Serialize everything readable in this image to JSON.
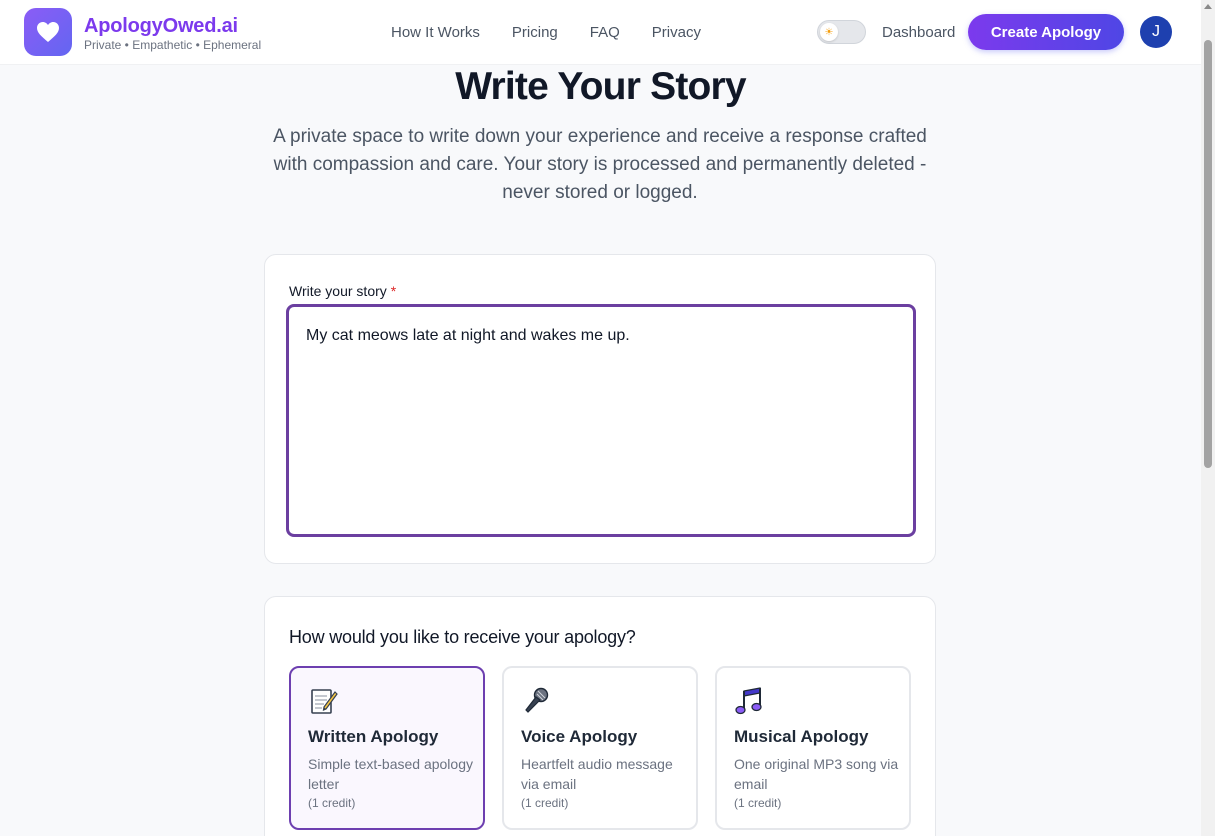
{
  "brand": {
    "name": "ApologyOwed.ai",
    "tagline": "Private • Empathetic • Ephemeral"
  },
  "nav": {
    "items": [
      {
        "label": "How It Works"
      },
      {
        "label": "Pricing"
      },
      {
        "label": "FAQ"
      },
      {
        "label": "Privacy"
      }
    ],
    "dashboard_label": "Dashboard",
    "create_label": "Create Apology",
    "avatar_initial": "J",
    "theme_toggle_icon": "sun-icon"
  },
  "hero": {
    "title": "Write Your Story",
    "subtitle": "A private space to write down your experience and receive a response crafted with compassion and care. Your story is processed and permanently deleted - never stored or logged."
  },
  "story": {
    "label": "Write your story",
    "required_marker": "*",
    "value": "My cat meows late at night and wakes me up."
  },
  "delivery": {
    "title": "How would you like to receive your apology?",
    "options": [
      {
        "icon": "memo-icon",
        "title": "Written Apology",
        "description": "Simple text-based apology letter",
        "credit": "(1 credit)",
        "selected": true
      },
      {
        "icon": "microphone-icon",
        "title": "Voice Apology",
        "description": "Heartfelt audio message via email",
        "credit": "(1 credit)",
        "selected": false
      },
      {
        "icon": "music-notes-icon",
        "title": "Musical Apology",
        "description": "One original MP3 song via email",
        "credit": "(1 credit)",
        "selected": false
      }
    ]
  },
  "colors": {
    "brand": "#7c3aed",
    "accent_gradient_end": "#4f46e5",
    "selected_border": "#6d3fb0",
    "avatar_bg": "#1e40af"
  }
}
